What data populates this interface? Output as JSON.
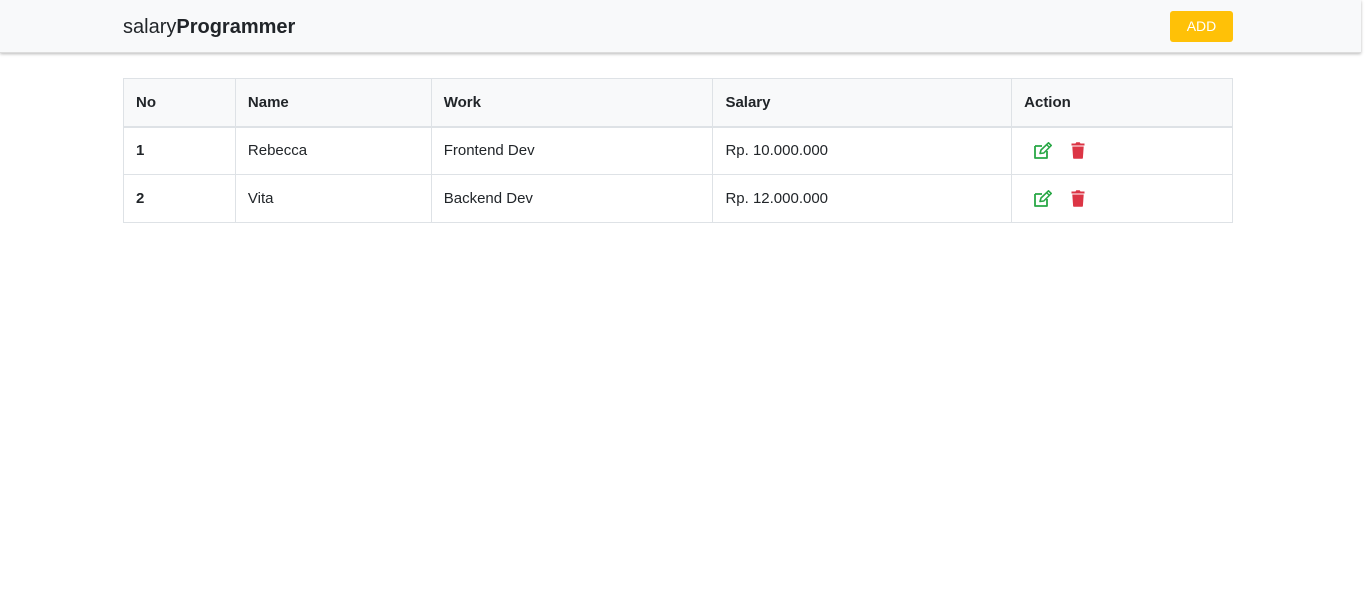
{
  "navbar": {
    "brand_light": "salary",
    "brand_bold": "Programmer",
    "add_label": "ADD"
  },
  "colors": {
    "accent_add": "#ffc107",
    "edit_icon": "#28a745",
    "delete_icon": "#dc3545"
  },
  "table": {
    "headers": {
      "no": "No",
      "name": "Name",
      "work": "Work",
      "salary": "Salary",
      "action": "Action"
    },
    "rows": [
      {
        "no": "1",
        "name": "Rebecca",
        "work": "Frontend Dev",
        "salary": "Rp. 10.000.000",
        "actions": [
          "edit-icon",
          "trash-icon"
        ]
      },
      {
        "no": "2",
        "name": "Vita",
        "work": "Backend Dev",
        "salary": "Rp. 12.000.000",
        "actions": [
          "edit-icon",
          "trash-icon"
        ]
      }
    ]
  }
}
